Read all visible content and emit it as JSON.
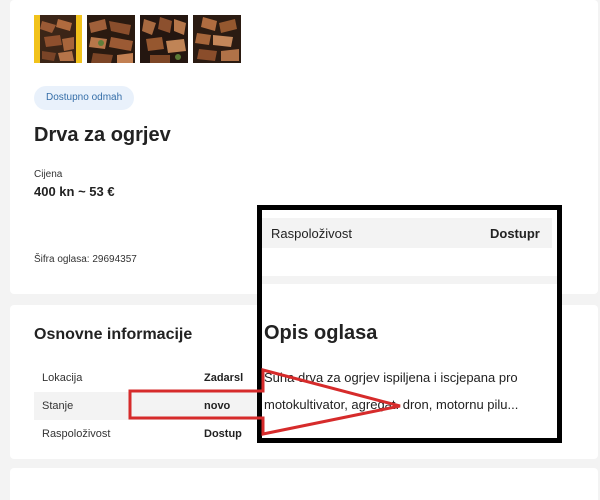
{
  "listing": {
    "thumbnails": [
      {
        "name": "thumbnail-1",
        "selected": true
      },
      {
        "name": "thumbnail-2",
        "selected": false
      },
      {
        "name": "thumbnail-3",
        "selected": false
      },
      {
        "name": "thumbnail-4",
        "selected": false
      }
    ],
    "badge": "Dostupno odmah",
    "title": "Drva za ogrjev",
    "price_label": "Cijena",
    "price_value": "400 kn ~ 53 €",
    "ad_code": "Šifra oglasa: 29694357"
  },
  "basic_info": {
    "title": "Osnovne informacije",
    "rows": [
      {
        "key": "Lokacija",
        "value": "Zadarsl"
      },
      {
        "key": "Stanje",
        "value": "novo"
      },
      {
        "key": "Raspoloživost",
        "value": "Dostup"
      }
    ]
  },
  "zoom": {
    "row_key": "Raspoloživost",
    "row_value": "Dostupr",
    "section_title": "Opis oglasa",
    "desc_line1": "Suha drva za ogrjev ispiljena i iscjepana pro",
    "desc_line2": "motokultivator, agregat. dron, motornu pilu..."
  },
  "colors": {
    "highlight_red": "#d62b2b",
    "badge_bg": "#e9f1fb",
    "badge_text": "#356ea8",
    "selected_thumb": "#f1c21b"
  }
}
